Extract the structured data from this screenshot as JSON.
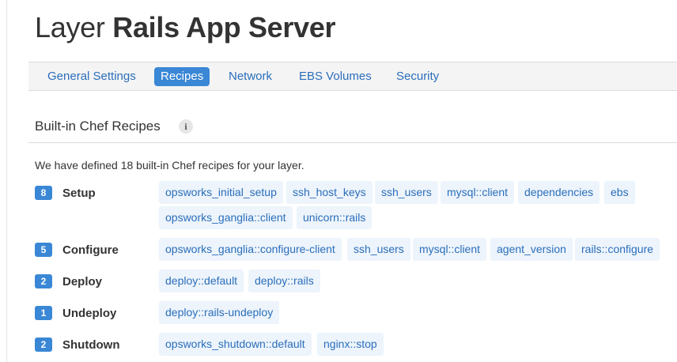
{
  "page_title": {
    "prefix": "Layer",
    "name": "Rails App Server"
  },
  "tabs": [
    {
      "label": "General Settings",
      "active": false
    },
    {
      "label": "Recipes",
      "active": true
    },
    {
      "label": "Network",
      "active": false
    },
    {
      "label": "EBS Volumes",
      "active": false
    },
    {
      "label": "Security",
      "active": false
    }
  ],
  "section": {
    "title": "Built-in Chef Recipes",
    "info_icon": "info-icon"
  },
  "intro": "We have defined 18 built-in Chef recipes for your layer.",
  "events": [
    {
      "count": "8",
      "name": "Setup",
      "recipes": [
        "opsworks_initial_setup",
        "ssh_host_keys",
        "ssh_users",
        "mysql::client",
        "dependencies",
        "ebs",
        "opsworks_ganglia::client",
        "unicorn::rails"
      ]
    },
    {
      "count": "5",
      "name": "Configure",
      "recipes": [
        "opsworks_ganglia::configure-client",
        "ssh_users",
        "mysql::client",
        "agent_version",
        "rails::configure"
      ]
    },
    {
      "count": "2",
      "name": "Deploy",
      "recipes": [
        "deploy::default",
        "deploy::rails"
      ]
    },
    {
      "count": "1",
      "name": "Undeploy",
      "recipes": [
        "deploy::rails-undeploy"
      ]
    },
    {
      "count": "2",
      "name": "Shutdown",
      "recipes": [
        "opsworks_shutdown::default",
        "nginx::stop"
      ]
    }
  ],
  "colors": {
    "accent": "#3a87d6",
    "link": "#2a6ebb",
    "chip_bg": "#edf4fb"
  }
}
